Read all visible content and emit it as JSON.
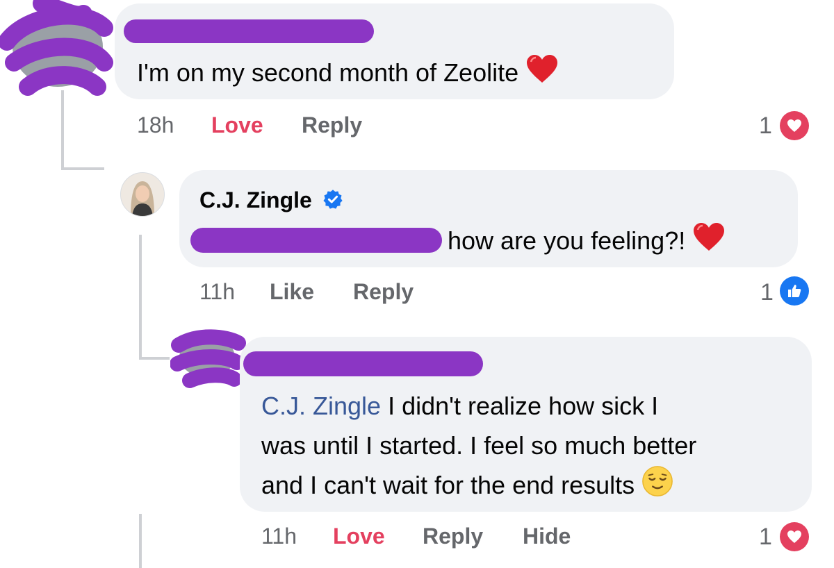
{
  "comment1": {
    "text": "I'm on my second month of Zeolite",
    "time": "18h",
    "actions": {
      "react": "Love",
      "reply": "Reply"
    },
    "reaction_count": "1",
    "reaction_icon": "love-reaction-icon",
    "inline_emoji": "red-heart-icon"
  },
  "comment2": {
    "author": "C.J. Zingle",
    "verified_icon": "verified-badge-icon",
    "text": "how are you feeling?!",
    "time": "11h",
    "actions": {
      "react": "Like",
      "reply": "Reply"
    },
    "reaction_count": "1",
    "reaction_icon": "like-reaction-icon",
    "inline_emoji": "red-heart-icon"
  },
  "comment3": {
    "mention": "C.J. Zingle",
    "lines": [
      " I didn't realize how sick I",
      "was until I started. I feel so much better",
      "and I can't wait for the end results"
    ],
    "time": "11h",
    "actions": {
      "react": "Love",
      "reply": "Reply",
      "hide": "Hide"
    },
    "reaction_count": "1",
    "reaction_icon": "love-reaction-icon",
    "inline_emoji": "relieved-face-icon"
  },
  "colors": {
    "bubble": "#f0f2f5",
    "secondary_text": "#65676b",
    "love": "#e4405f",
    "like": "#1877f2",
    "mention": "#385898",
    "redaction": "#8b36c4"
  }
}
